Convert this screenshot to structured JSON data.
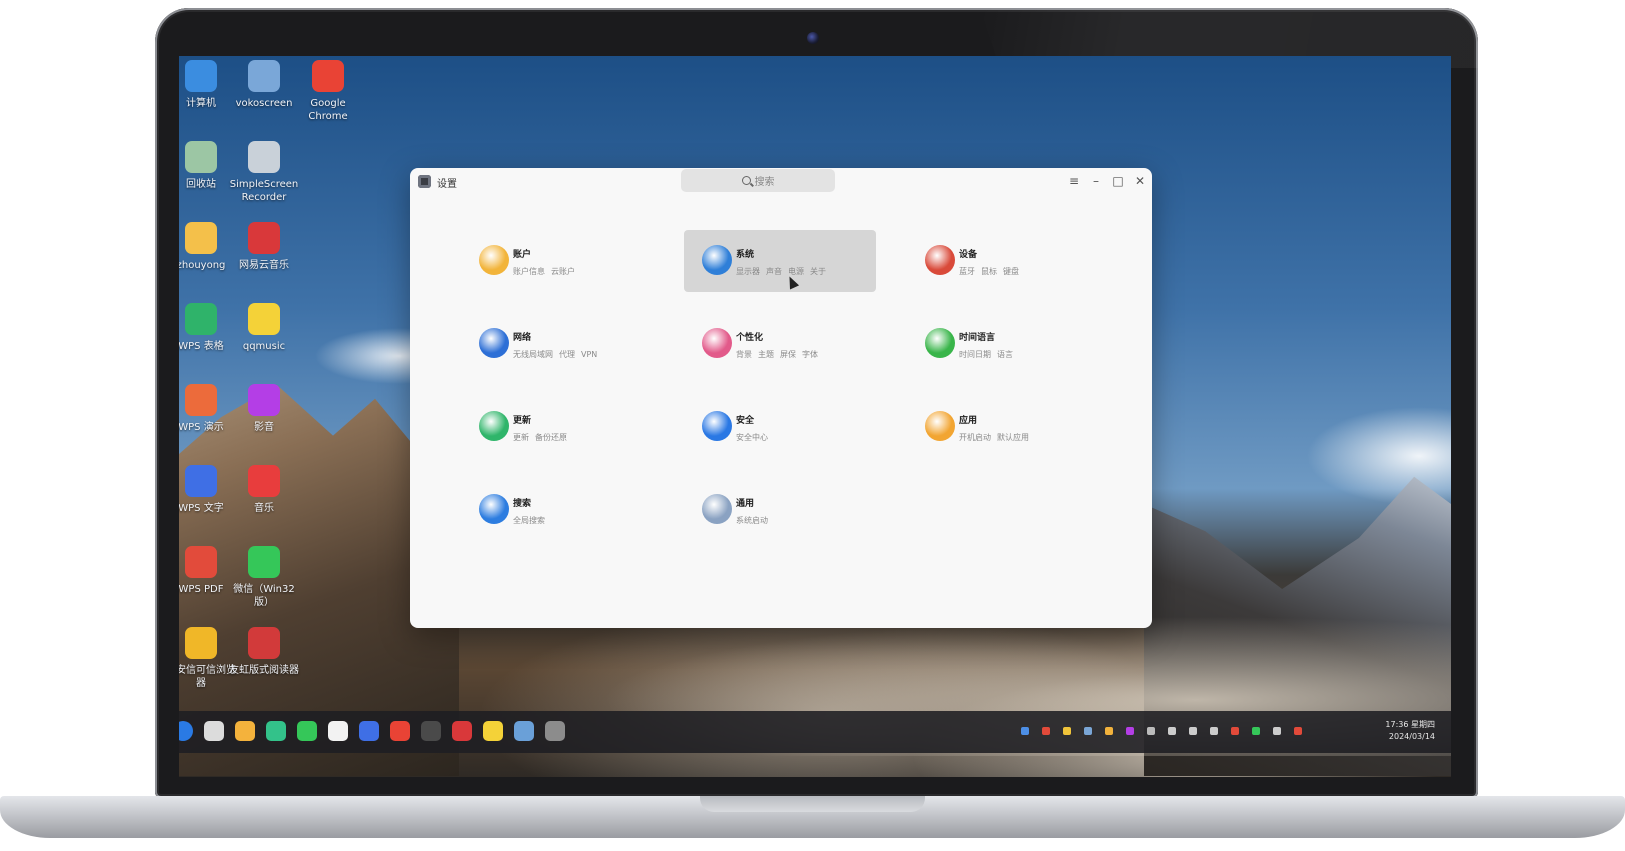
{
  "desktop": {
    "icons": [
      {
        "label": "计算机",
        "icon": "computer-icon",
        "color": "#3b8de0"
      },
      {
        "label": "vokoscreen",
        "icon": "vokoscreen-icon",
        "color": "#7aa7d8"
      },
      {
        "label": "Google Chrome",
        "icon": "chrome-icon",
        "color": "#e94335"
      },
      {
        "label": "回收站",
        "icon": "trash-icon",
        "color": "#9cc6a4"
      },
      {
        "label": "SimpleScreen Recorder",
        "icon": "screen-recorder-icon",
        "color": "#c9d1d9"
      },
      {
        "label": "zhouyong",
        "icon": "folder-icon",
        "color": "#f4c04a"
      },
      {
        "label": "网易云音乐",
        "icon": "netease-music-icon",
        "color": "#d9383a"
      },
      {
        "label": "WPS 表格",
        "icon": "wps-sheet-icon",
        "color": "#2fb36a"
      },
      {
        "label": "qqmusic",
        "icon": "qqmusic-icon",
        "color": "#f4d238"
      },
      {
        "label": "WPS 演示",
        "icon": "wps-slides-icon",
        "color": "#ec6b3b"
      },
      {
        "label": "影音",
        "icon": "media-player-icon",
        "color": "#b43ee6"
      },
      {
        "label": "WPS 文字",
        "icon": "wps-writer-icon",
        "color": "#3f6fe5"
      },
      {
        "label": "音乐",
        "icon": "music-icon",
        "color": "#e83d3d"
      },
      {
        "label": "WPS PDF",
        "icon": "wps-pdf-icon",
        "color": "#e24b3b"
      },
      {
        "label": "微信（Win32版）",
        "icon": "wechat-icon",
        "color": "#35c759"
      },
      {
        "label": "奇安信可信浏览器",
        "icon": "qax-browser-icon",
        "color": "#f0b728"
      },
      {
        "label": "友虹版式阅读器",
        "icon": "ofd-reader-icon",
        "color": "#d23a3a"
      }
    ]
  },
  "window": {
    "title": "设置",
    "search_placeholder": "搜索",
    "controls": {
      "menu": "≡",
      "minimize": "–",
      "maximize": "□",
      "close": "✕"
    },
    "tiles": [
      {
        "name": "账户",
        "subs": [
          "账户信息",
          "云账户"
        ],
        "icon": "user-icon",
        "color": "#f2b43a",
        "active": false
      },
      {
        "name": "系统",
        "subs": [
          "显示器",
          "声音",
          "电源",
          "关于"
        ],
        "icon": "monitor-icon",
        "color": "#2f7fd8",
        "active": true
      },
      {
        "name": "设备",
        "subs": [
          "蓝牙",
          "鼠标",
          "键盘"
        ],
        "icon": "tools-icon",
        "color": "#d94a3a",
        "active": false
      },
      {
        "name": "网络",
        "subs": [
          "无线局域网",
          "代理",
          "VPN"
        ],
        "icon": "globe-icon",
        "color": "#2d6fd6",
        "active": false
      },
      {
        "name": "个性化",
        "subs": [
          "背景",
          "主题",
          "屏保",
          "字体"
        ],
        "icon": "palette-icon",
        "color": "#e25a8a",
        "active": false
      },
      {
        "name": "时间语言",
        "subs": [
          "时间日期",
          "语言"
        ],
        "icon": "chat-clock-icon",
        "color": "#39b54a",
        "active": false
      },
      {
        "name": "更新",
        "subs": [
          "更新",
          "备份还原"
        ],
        "icon": "update-icon",
        "color": "#2fb56a",
        "active": false
      },
      {
        "name": "安全",
        "subs": [
          "安全中心"
        ],
        "icon": "shield-icon",
        "color": "#2a78e4",
        "active": false
      },
      {
        "name": "应用",
        "subs": [
          "开机启动",
          "默认应用"
        ],
        "icon": "apps-icon",
        "color": "#f2a532",
        "active": false
      },
      {
        "name": "搜索",
        "subs": [
          "全局搜索"
        ],
        "icon": "search-icon",
        "color": "#2d7de0",
        "active": false
      },
      {
        "name": "通用",
        "subs": [
          "系统启动"
        ],
        "icon": "gear-icon",
        "color": "#8aa2c2",
        "active": false
      }
    ]
  },
  "taskbar": {
    "apps": [
      {
        "icon": "start-menu-icon",
        "color": "#2a7ae4"
      },
      {
        "icon": "multitask-icon",
        "color": "#dcdcdc"
      },
      {
        "icon": "file-manager-icon",
        "color": "#f4b23c"
      },
      {
        "icon": "mail-icon",
        "color": "#33c28a"
      },
      {
        "icon": "wechat-icon",
        "color": "#35c759"
      },
      {
        "icon": "document-icon",
        "color": "#f2f2f2"
      },
      {
        "icon": "wps-writer-icon",
        "color": "#3f6fe5"
      },
      {
        "icon": "chrome-icon",
        "color": "#e94335"
      },
      {
        "icon": "terminal-icon",
        "color": "#4a4a4a"
      },
      {
        "icon": "netease-music-icon",
        "color": "#d9383a"
      },
      {
        "icon": "qqmusic-icon",
        "color": "#f4d238"
      },
      {
        "icon": "image-viewer-icon",
        "color": "#6aa0d8"
      },
      {
        "icon": "settings-icon",
        "color": "#8c8c8c"
      }
    ],
    "tray": [
      {
        "icon": "tray-app-icon-1",
        "color": "#4d8fe6"
      },
      {
        "icon": "tray-app-icon-2",
        "color": "#e24a3a"
      },
      {
        "icon": "tray-app-icon-3",
        "color": "#f0c43a"
      },
      {
        "icon": "tray-app-icon-4",
        "color": "#7aa6d6"
      },
      {
        "icon": "tray-app-icon-5",
        "color": "#f2b23c"
      },
      {
        "icon": "tray-app-icon-6",
        "color": "#b43ee6"
      },
      {
        "icon": "chevron-right-icon",
        "color": "#bbbbbb"
      },
      {
        "icon": "search-icon",
        "color": "#cccccc"
      },
      {
        "icon": "screenshot-icon",
        "color": "#cccccc"
      },
      {
        "icon": "volume-icon",
        "color": "#cccccc"
      },
      {
        "icon": "tray-app-icon-7",
        "color": "#e24a3a"
      },
      {
        "icon": "wechat-tray-icon",
        "color": "#35c759"
      },
      {
        "icon": "network-icon",
        "color": "#cccccc"
      },
      {
        "icon": "notification-icon",
        "color": "#e24a3a"
      }
    ],
    "time": "17:36 星期四",
    "date": "2024/03/14"
  }
}
